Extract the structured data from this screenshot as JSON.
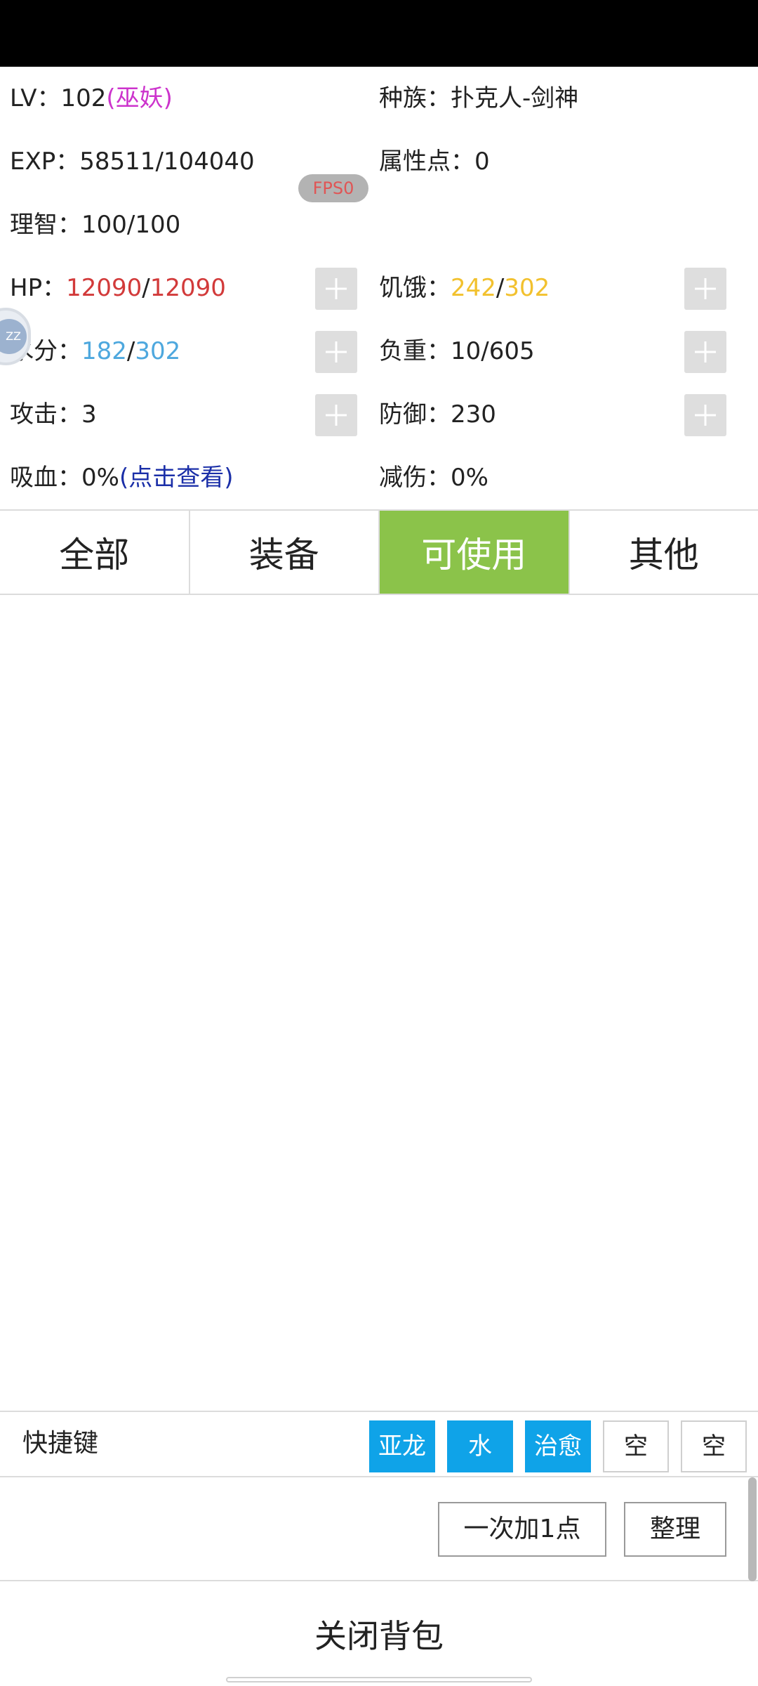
{
  "stats": {
    "lv_label": "LV：",
    "lv_value": "102",
    "lv_class": "(巫妖)",
    "race_label": "种族：",
    "race_value": "扑克人-剑神",
    "exp_label": "EXP：",
    "exp_value": "58511/104040",
    "attr_points_label": "属性点：",
    "attr_points_value": "0",
    "sanity_label": "理智：",
    "sanity_value": "100/100",
    "hp_label": "HP：",
    "hp_current": "12090",
    "hp_sep": "/",
    "hp_max": "12090",
    "hunger_label": "饥饿：",
    "hunger_current": "242",
    "hunger_sep": "/",
    "hunger_max": "302",
    "water_label": "水分：",
    "water_current": "182",
    "water_sep": "/",
    "water_max": "302",
    "weight_label": "负重：",
    "weight_value": "10/605",
    "attack_label": "攻击：",
    "attack_value": "3",
    "defense_label": "防御：",
    "defense_value": "230",
    "lifesteal_label": "吸血：",
    "lifesteal_value": "0%",
    "lifesteal_link": "(点击查看)",
    "damage_reduction_label": "减伤：",
    "damage_reduction_value": "0%"
  },
  "fps_badge": "FPS0",
  "float_ball_text": "ZZ",
  "tabs": [
    {
      "label": "全部",
      "active": false
    },
    {
      "label": "装备",
      "active": false
    },
    {
      "label": "可使用",
      "active": true
    },
    {
      "label": "其他",
      "active": false
    }
  ],
  "quickbar": {
    "label": "快捷键",
    "slots": [
      {
        "label": "亚龙",
        "filled": true
      },
      {
        "label": "水",
        "filled": true
      },
      {
        "label": "治愈",
        "filled": true
      },
      {
        "label": "空",
        "filled": false
      },
      {
        "label": "空",
        "filled": false
      }
    ]
  },
  "actions": {
    "add_one_label": "一次加1点",
    "sort_label": "整理"
  },
  "close_label": "关闭背包",
  "colors": {
    "active_tab": "#8bc34a",
    "quick_slot_filled": "#0fa3e8",
    "hp": "#d23a3a",
    "hunger": "#f2c12e",
    "water": "#4ea8de",
    "class_name": "#cc33cc",
    "link": "#1b2fa8"
  }
}
